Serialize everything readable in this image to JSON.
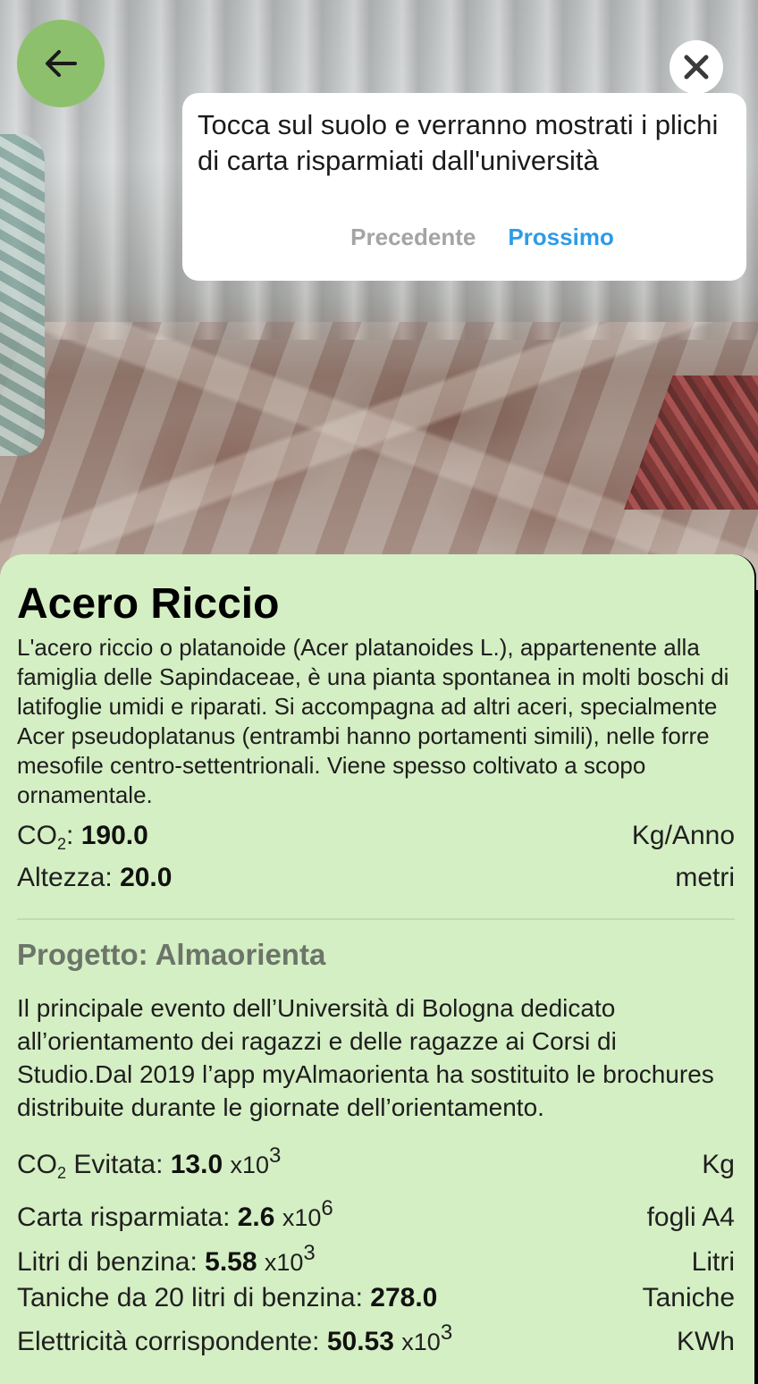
{
  "navigation": {
    "back_icon": "arrow-left-icon",
    "close_icon": "close-icon"
  },
  "tutorial": {
    "text": "Tocca sul suolo e verranno mostrati i plichi di carta risparmiati dall'università",
    "prev_label": "Precedente",
    "next_label": "Prossimo"
  },
  "species": {
    "name": "Acero Riccio",
    "description": "L'acero riccio o platanoide (Acer platanoides L.), appartenente alla famiglia delle Sapindaceae, è una pianta spontanea in molti boschi di latifoglie umidi e riparati. Si accompagna ad altri aceri, specialmente Acer pseudoplatanus (entrambi hanno portamenti simili), nelle forre mesofile centro-settentrionali. Viene spesso coltivato a scopo ornamentale.",
    "co2_label_main": "CO",
    "co2_label_sub": "2",
    "co2_label_suffix": ":",
    "co2_value": "190.0",
    "co2_unit": "Kg/Anno",
    "height_label": "Altezza:",
    "height_value": "20.0",
    "height_unit": "metri"
  },
  "project": {
    "title": "Progetto: Almaorienta",
    "description": "Il principale evento dell’Università di Bologna dedicato all’orientamento dei ragazzi e delle ragazze ai Corsi di Studio.Dal 2019 l’app myAlmaorienta ha sostituito le brochures distribuite durante le giornate dell’orientamento.",
    "co2_avoided": {
      "label_main": "CO",
      "label_sub": "2",
      "label_suffix": " Evitata:",
      "value": "13.0",
      "multiplier": "x10",
      "exponent": "3",
      "unit": "Kg"
    },
    "paper_saved": {
      "label": "Carta risparmiata:",
      "value": "2.6",
      "multiplier": "x10",
      "exponent": "6",
      "unit": "fogli A4"
    },
    "petrol_liters": {
      "label": "Litri di benzina:",
      "value": "5.58",
      "multiplier": "x10",
      "exponent": "3",
      "unit": "Litri"
    },
    "petrol_tanks": {
      "label": "Taniche da 20 litri di benzina:",
      "value": "278.0",
      "unit": "Taniche"
    },
    "electricity": {
      "label": "Elettricità corrispondente:",
      "value": "50.53",
      "multiplier": "x10",
      "exponent": "3",
      "unit": "KWh"
    }
  }
}
